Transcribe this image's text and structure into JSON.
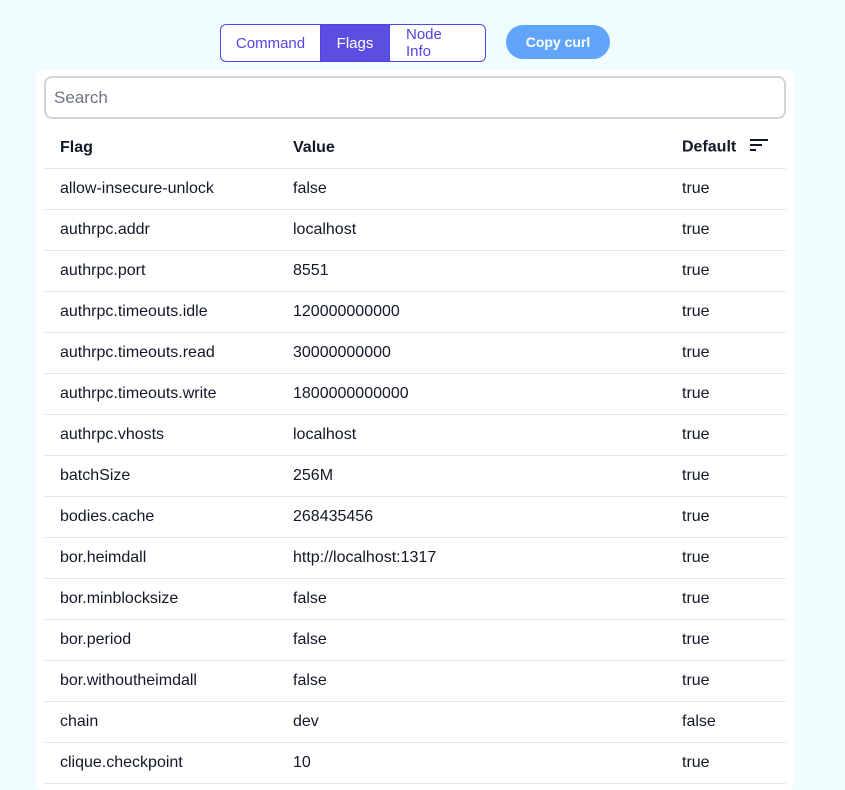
{
  "tabs": [
    {
      "label": "Command",
      "active": false
    },
    {
      "label": "Flags",
      "active": true
    },
    {
      "label": "Node Info",
      "active": false
    }
  ],
  "copy_button": "Copy curl",
  "search": {
    "placeholder": "Search",
    "value": ""
  },
  "table": {
    "headers": {
      "flag": "Flag",
      "value": "Value",
      "default": "Default"
    },
    "sort_icon": "sort-icon",
    "rows": [
      {
        "flag": "allow-insecure-unlock",
        "value": "false",
        "default": "true"
      },
      {
        "flag": "authrpc.addr",
        "value": "localhost",
        "default": "true"
      },
      {
        "flag": "authrpc.port",
        "value": "8551",
        "default": "true"
      },
      {
        "flag": "authrpc.timeouts.idle",
        "value": "120000000000",
        "default": "true"
      },
      {
        "flag": "authrpc.timeouts.read",
        "value": "30000000000",
        "default": "true"
      },
      {
        "flag": "authrpc.timeouts.write",
        "value": "1800000000000",
        "default": "true"
      },
      {
        "flag": "authrpc.vhosts",
        "value": "localhost",
        "default": "true"
      },
      {
        "flag": "batchSize",
        "value": "256M",
        "default": "true"
      },
      {
        "flag": "bodies.cache",
        "value": "268435456",
        "default": "true"
      },
      {
        "flag": "bor.heimdall",
        "value": "http://localhost:1317",
        "default": "true"
      },
      {
        "flag": "bor.minblocksize",
        "value": "false",
        "default": "true"
      },
      {
        "flag": "bor.period",
        "value": "false",
        "default": "true"
      },
      {
        "flag": "bor.withoutheimdall",
        "value": "false",
        "default": "true"
      },
      {
        "flag": "chain",
        "value": "dev",
        "default": "false"
      },
      {
        "flag": "clique.checkpoint",
        "value": "10",
        "default": "true"
      }
    ]
  },
  "colors": {
    "background": "#f0fdff",
    "accent": "#4f46e5",
    "active_tab": "#5b4ee0",
    "copy_button": "#60a5fa"
  }
}
